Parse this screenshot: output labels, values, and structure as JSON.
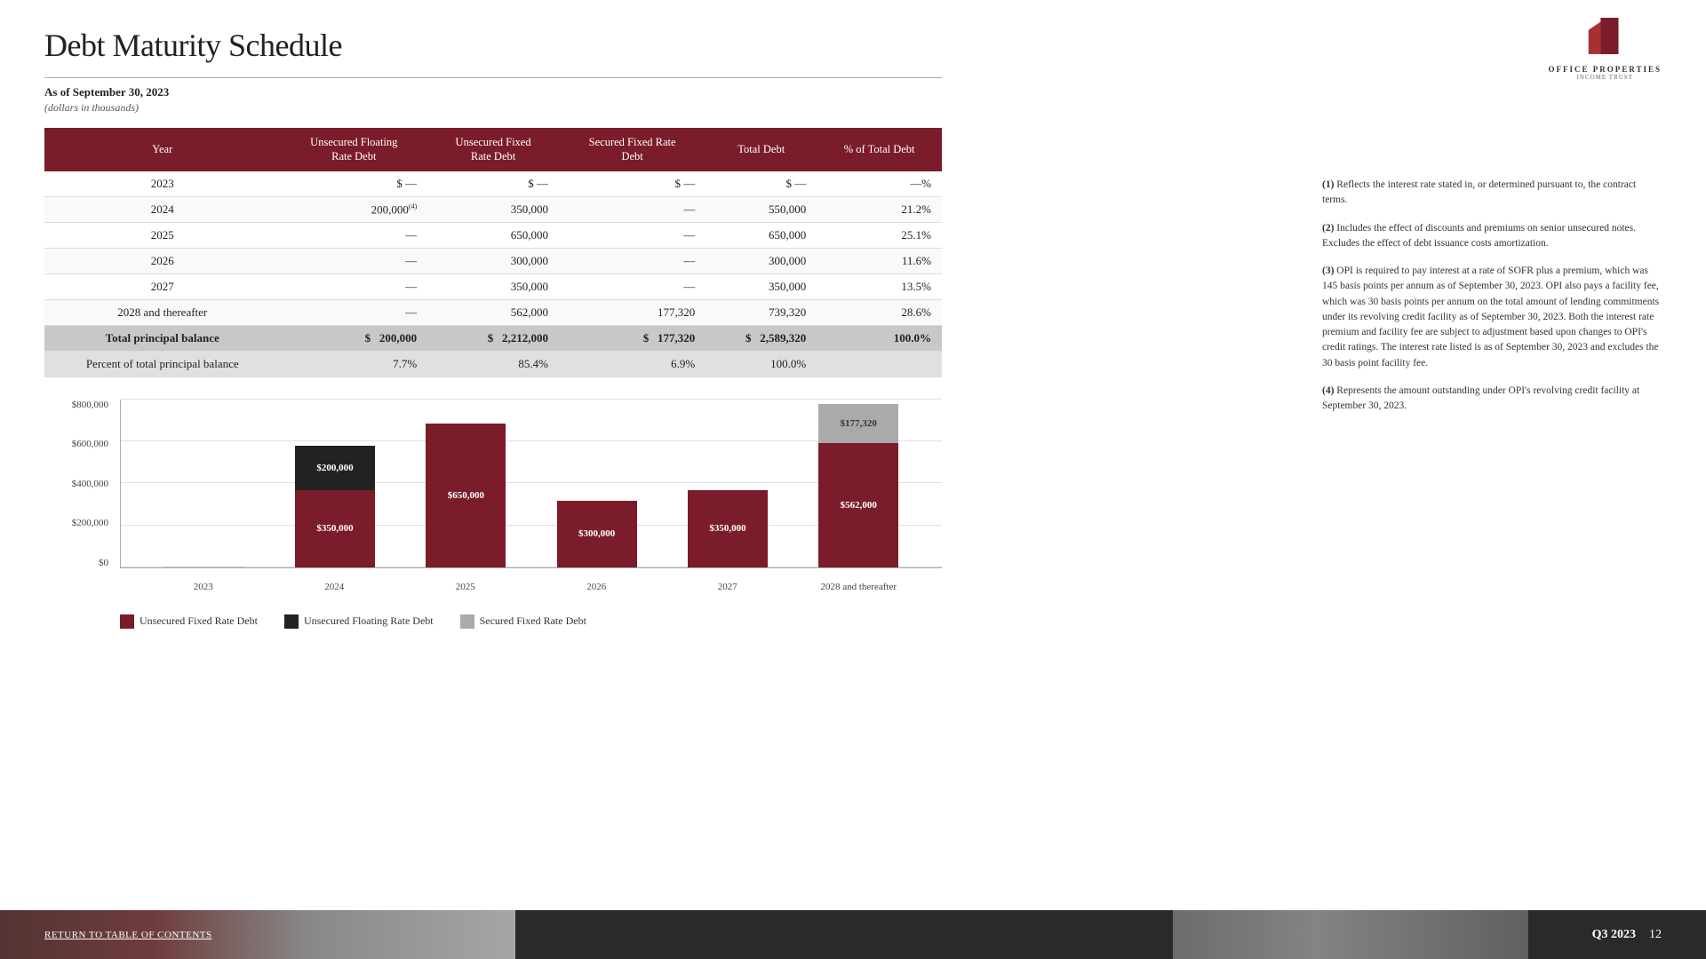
{
  "header": {
    "title": "Debt Maturity Schedule",
    "date": "As of September 30, 2023",
    "units": "(dollars in thousands)"
  },
  "logo": {
    "line1": "OFFICE PROPERTIES",
    "line2": "INCOME TRUST"
  },
  "table": {
    "columns": [
      "Year",
      "Unsecured Floating Rate Debt",
      "Unsecured Fixed Rate Debt",
      "Secured Fixed Rate Debt",
      "Total Debt",
      "% of Total Debt"
    ],
    "rows": [
      {
        "year": "2023",
        "ufloat_dollar": "$",
        "ufloat": "—",
        "ufixed_dollar": "$",
        "ufixed": "—",
        "secured_dollar": "$",
        "secured": "—",
        "total_dollar": "$",
        "total": "—",
        "pct": "—%"
      },
      {
        "year": "2024",
        "ufloat_dollar": "",
        "ufloat": "200,000",
        "ufloat_sup": "(4)",
        "ufixed_dollar": "",
        "ufixed": "350,000",
        "secured_dollar": "",
        "secured": "—",
        "total_dollar": "",
        "total": "550,000",
        "pct": "21.2%"
      },
      {
        "year": "2025",
        "ufloat_dollar": "",
        "ufloat": "—",
        "ufixed_dollar": "",
        "ufixed": "650,000",
        "secured_dollar": "",
        "secured": "—",
        "total_dollar": "",
        "total": "650,000",
        "pct": "25.1%"
      },
      {
        "year": "2026",
        "ufloat_dollar": "",
        "ufloat": "—",
        "ufixed_dollar": "",
        "ufixed": "300,000",
        "secured_dollar": "",
        "secured": "—",
        "total_dollar": "",
        "total": "300,000",
        "pct": "11.6%"
      },
      {
        "year": "2027",
        "ufloat_dollar": "",
        "ufloat": "—",
        "ufixed_dollar": "",
        "ufixed": "350,000",
        "secured_dollar": "",
        "secured": "—",
        "total_dollar": "",
        "total": "350,000",
        "pct": "13.5%"
      },
      {
        "year": "2028 and thereafter",
        "ufloat_dollar": "",
        "ufloat": "—",
        "ufixed_dollar": "",
        "ufixed": "562,000",
        "secured_dollar": "",
        "secured": "177,320",
        "total_dollar": "",
        "total": "739,320",
        "pct": "28.6%"
      }
    ],
    "total_row": {
      "label": "Total principal balance",
      "ufloat_dollar": "$",
      "ufloat": "200,000",
      "ufixed_dollar": "$",
      "ufixed": "2,212,000",
      "secured_dollar": "$",
      "secured": "177,320",
      "total_dollar": "$",
      "total": "2,589,320",
      "pct": "100.0%"
    },
    "percent_row": {
      "label": "Percent of total principal balance",
      "ufloat": "7.7%",
      "ufixed": "85.4%",
      "secured": "6.9%",
      "total": "100.0%",
      "pct": ""
    }
  },
  "chart": {
    "y_labels": [
      "$800,000",
      "$600,000",
      "$400,000",
      "$200,000",
      "$0"
    ],
    "x_labels": [
      "2023",
      "2024",
      "2025",
      "2026",
      "2027",
      "2028 and thereafter"
    ],
    "bars": [
      {
        "year": "2023",
        "unsecured_fixed": 0,
        "unsecured_floating": 0,
        "secured": 0
      },
      {
        "year": "2024",
        "unsecured_fixed": 350000,
        "unsecured_floating": 200000,
        "secured": 0,
        "uf_label": "$350,000",
        "ufl_label": "$200,000"
      },
      {
        "year": "2025",
        "unsecured_fixed": 650000,
        "unsecured_floating": 0,
        "secured": 0,
        "uf_label": "$650,000"
      },
      {
        "year": "2026",
        "unsecured_fixed": 300000,
        "unsecured_floating": 0,
        "secured": 0,
        "uf_label": "$300,000"
      },
      {
        "year": "2027",
        "unsecured_fixed": 350000,
        "unsecured_floating": 0,
        "secured": 0,
        "uf_label": "$350,000"
      },
      {
        "year": "2028 and thereafter",
        "unsecured_fixed": 562000,
        "unsecured_floating": 0,
        "secured": 177320,
        "uf_label": "$562,000",
        "sec_label": "$177,320"
      }
    ],
    "legend": [
      {
        "label": "Unsecured Fixed Rate Debt",
        "color": "#7b1c2a"
      },
      {
        "label": "Unsecured Floating Rate Debt",
        "color": "#222"
      },
      {
        "label": "Secured Fixed Rate Debt",
        "color": "#aaa"
      }
    ]
  },
  "notes": [
    {
      "num": "(1)",
      "text": "Reflects the interest rate stated in, or determined pursuant to, the contract terms."
    },
    {
      "num": "(2)",
      "text": "Includes the effect of discounts and premiums on senior unsecured notes. Excludes the effect of debt issuance costs amortization."
    },
    {
      "num": "(3)",
      "text": "OPI is required to pay interest at a rate of SOFR plus a premium, which was 145 basis points per annum as of September 30, 2023. OPI also pays a facility fee, which was 30 basis points per annum on the total amount of lending commitments under its revolving credit facility as of September 30, 2023. Both the interest rate premium and facility fee are subject to adjustment based upon changes to OPI's credit ratings. The interest rate listed is as of September 30, 2023 and excludes the 30 basis point facility fee."
    },
    {
      "num": "(4)",
      "text": "Represents the amount outstanding under OPI's revolving credit facility at September 30, 2023."
    }
  ],
  "footer": {
    "link": "RETURN TO TABLE OF CONTENTS",
    "quarter": "Q3 2023",
    "page": "12"
  }
}
